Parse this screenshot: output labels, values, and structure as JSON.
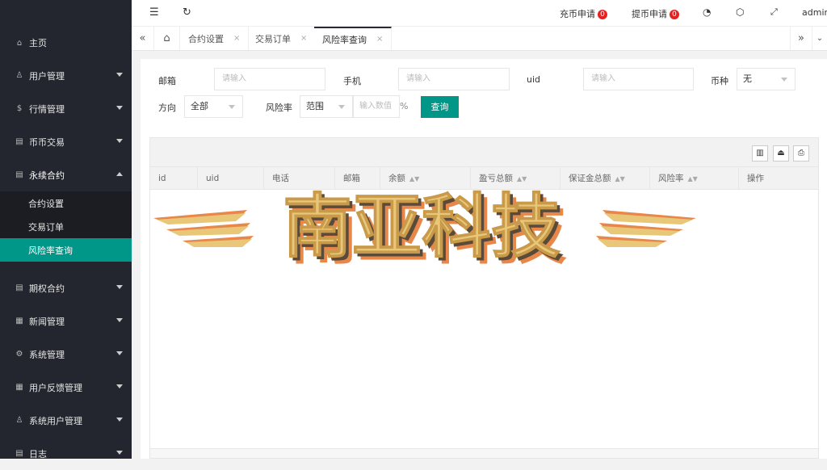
{
  "sidebar": {
    "items": [
      {
        "label": "主页",
        "icon": "home-icon",
        "glyph": "⌂"
      },
      {
        "label": "用户管理",
        "icon": "user-icon",
        "glyph": "♙"
      },
      {
        "label": "行情管理",
        "icon": "dollar-icon",
        "glyph": "$"
      },
      {
        "label": "币币交易",
        "icon": "doc-icon",
        "glyph": "▤"
      },
      {
        "label": "永续合约",
        "icon": "doc-icon",
        "glyph": "▤"
      },
      {
        "label": "期权合约",
        "icon": "doc-icon",
        "glyph": "▤"
      },
      {
        "label": "新闻管理",
        "icon": "news-icon",
        "glyph": "▦"
      },
      {
        "label": "系统管理",
        "icon": "gear-icon",
        "glyph": "⚙"
      },
      {
        "label": "用户反馈管理",
        "icon": "news-icon",
        "glyph": "▦"
      },
      {
        "label": "系统用户管理",
        "icon": "user-icon",
        "glyph": "♙"
      },
      {
        "label": "日志",
        "icon": "doc-icon",
        "glyph": "▤"
      }
    ],
    "subitems": [
      {
        "label": "合约设置"
      },
      {
        "label": "交易订单"
      },
      {
        "label": "风险率查询"
      }
    ]
  },
  "topbar": {
    "recharge_label": "充币申请",
    "recharge_count": "0",
    "withdraw_label": "提币申请",
    "withdraw_count": "0",
    "user": "admin"
  },
  "tabs": [
    {
      "label": "合约设置",
      "close": "×"
    },
    {
      "label": "交易订单",
      "close": "×"
    },
    {
      "label": "风险率查询",
      "close": "×"
    }
  ],
  "form": {
    "email_label": "邮箱",
    "email_placeholder": "请输入",
    "phone_label": "手机",
    "phone_placeholder": "请输入",
    "uid_label": "uid",
    "uid_placeholder": "请输入",
    "coin_label": "币种",
    "coin_value": "无",
    "direction_label": "方向",
    "direction_value": "全部",
    "risk_label": "风险率",
    "range_value": "范围",
    "value_placeholder": "输入数值",
    "percent": "%",
    "query_button": "查询"
  },
  "table": {
    "columns": [
      {
        "label": "id",
        "sortable": false
      },
      {
        "label": "uid",
        "sortable": false
      },
      {
        "label": "电话",
        "sortable": false
      },
      {
        "label": "邮箱",
        "sortable": false
      },
      {
        "label": "余额",
        "sortable": true
      },
      {
        "label": "盈亏总额",
        "sortable": true
      },
      {
        "label": "保证金总额",
        "sortable": true
      },
      {
        "label": "风险率",
        "sortable": true
      },
      {
        "label": "操作",
        "sortable": false
      }
    ],
    "sort_glyph": "▲▼"
  },
  "watermark": {
    "text": "南亚科技",
    "colors": {
      "gold": "#e8c878",
      "shadow": "#5a4a3a",
      "orange": "#e8874a"
    }
  },
  "colors": {
    "accent": "#009688",
    "sidebar_bg": "#23262e",
    "badge": "#e82020"
  }
}
